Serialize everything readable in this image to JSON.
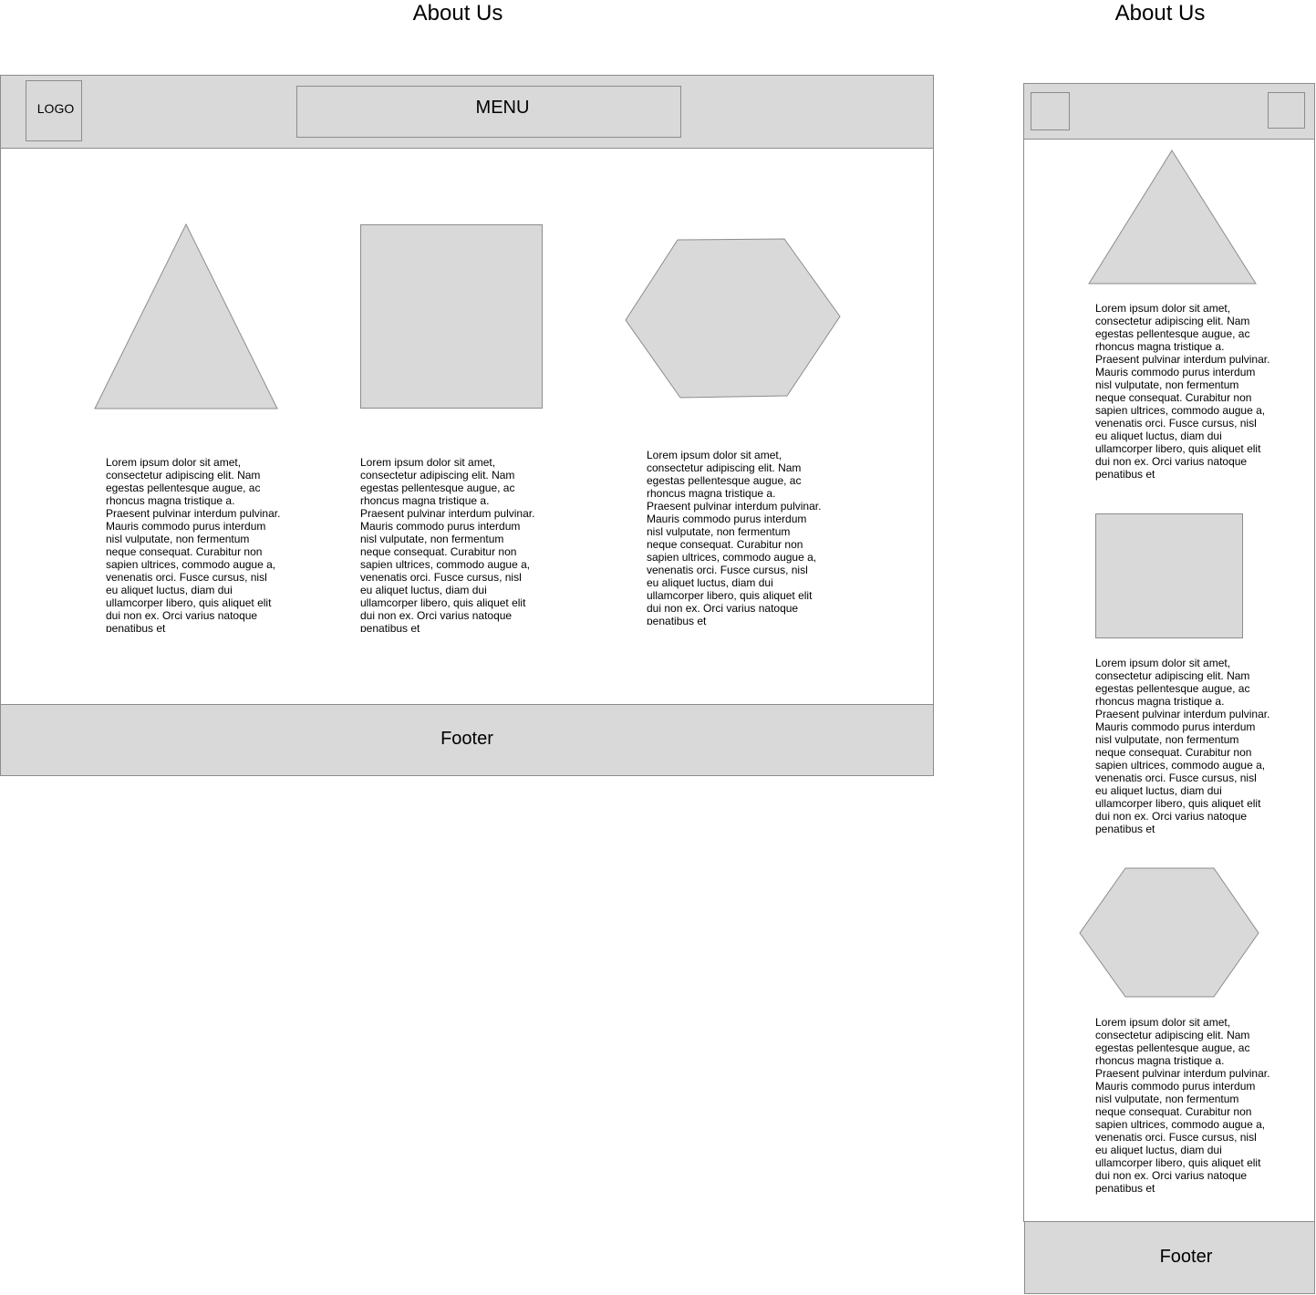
{
  "desktop": {
    "title": "About Us",
    "header": {
      "logo_label": "LOGO",
      "menu_label": "MENU"
    },
    "shapes": [
      {
        "icon": "triangle-placeholder"
      },
      {
        "icon": "square-placeholder"
      },
      {
        "icon": "hexagon-placeholder"
      }
    ],
    "columns": [
      {
        "text": "Lorem ipsum dolor sit amet, consectetur adipiscing elit. Nam egestas pellentesque augue, ac rhoncus magna tristique a. Praesent pulvinar interdum pulvinar. Mauris commodo purus interdum nisl vulputate, non fermentum neque consequat. Curabitur non sapien ultrices, commodo augue a, venenatis orci. Fusce cursus, nisl eu aliquet luctus, diam dui ullamcorper libero, quis aliquet elit dui non ex. Orci varius natoque penatibus et"
      },
      {
        "text": "Lorem ipsum dolor sit amet, consectetur adipiscing elit. Nam egestas pellentesque augue, ac rhoncus magna tristique a. Praesent pulvinar interdum pulvinar. Mauris commodo purus interdum nisl vulputate, non fermentum neque consequat. Curabitur non sapien ultrices, commodo augue a, venenatis orci. Fusce cursus, nisl eu aliquet luctus, diam dui ullamcorper libero, quis aliquet elit dui non ex. Orci varius natoque penatibus et"
      },
      {
        "text": "Lorem ipsum dolor sit amet, consectetur adipiscing elit. Nam egestas pellentesque augue, ac rhoncus magna tristique a. Praesent pulvinar interdum pulvinar. Mauris commodo purus interdum nisl vulputate, non fermentum neque consequat. Curabitur non sapien ultrices, commodo augue a, venenatis orci. Fusce cursus, nisl eu aliquet luctus, diam dui ullamcorper libero, quis aliquet elit dui non ex. Orci varius natoque penatibus et"
      }
    ],
    "footer_label": "Footer"
  },
  "mobile": {
    "title": "About Us",
    "shapes": [
      {
        "icon": "triangle-placeholder"
      },
      {
        "icon": "square-placeholder"
      },
      {
        "icon": "hexagon-placeholder"
      }
    ],
    "blocks": [
      {
        "text": "Lorem ipsum dolor sit amet, consectetur adipiscing elit. Nam egestas pellentesque augue, ac rhoncus magna tristique a. Praesent pulvinar interdum pulvinar. Mauris commodo purus interdum nisl vulputate, non fermentum neque consequat. Curabitur non sapien ultrices, commodo augue a, venenatis orci. Fusce cursus, nisl eu aliquet luctus, diam dui ullamcorper libero, quis aliquet elit dui non ex. Orci varius natoque penatibus et"
      },
      {
        "text": "Lorem ipsum dolor sit amet, consectetur adipiscing elit. Nam egestas pellentesque augue, ac rhoncus magna tristique a. Praesent pulvinar interdum pulvinar. Mauris commodo purus interdum nisl vulputate, non fermentum neque consequat. Curabitur non sapien ultrices, commodo augue a, venenatis orci. Fusce cursus, nisl eu aliquet luctus, diam dui ullamcorper libero, quis aliquet elit dui non ex. Orci varius natoque penatibus et"
      },
      {
        "text": "Lorem ipsum dolor sit amet, consectetur adipiscing elit. Nam egestas pellentesque augue, ac rhoncus magna tristique a. Praesent pulvinar interdum pulvinar. Mauris commodo purus interdum nisl vulputate, non fermentum neque consequat. Curabitur non sapien ultrices, commodo augue a, venenatis orci. Fusce cursus, nisl eu aliquet luctus, diam dui ullamcorper libero, quis aliquet elit dui non ex. Orci varius natoque penatibus et"
      }
    ],
    "footer_label": "Footer"
  },
  "colors": {
    "placeholder_fill": "#d9d9d9",
    "outline": "#8c8c8c"
  }
}
